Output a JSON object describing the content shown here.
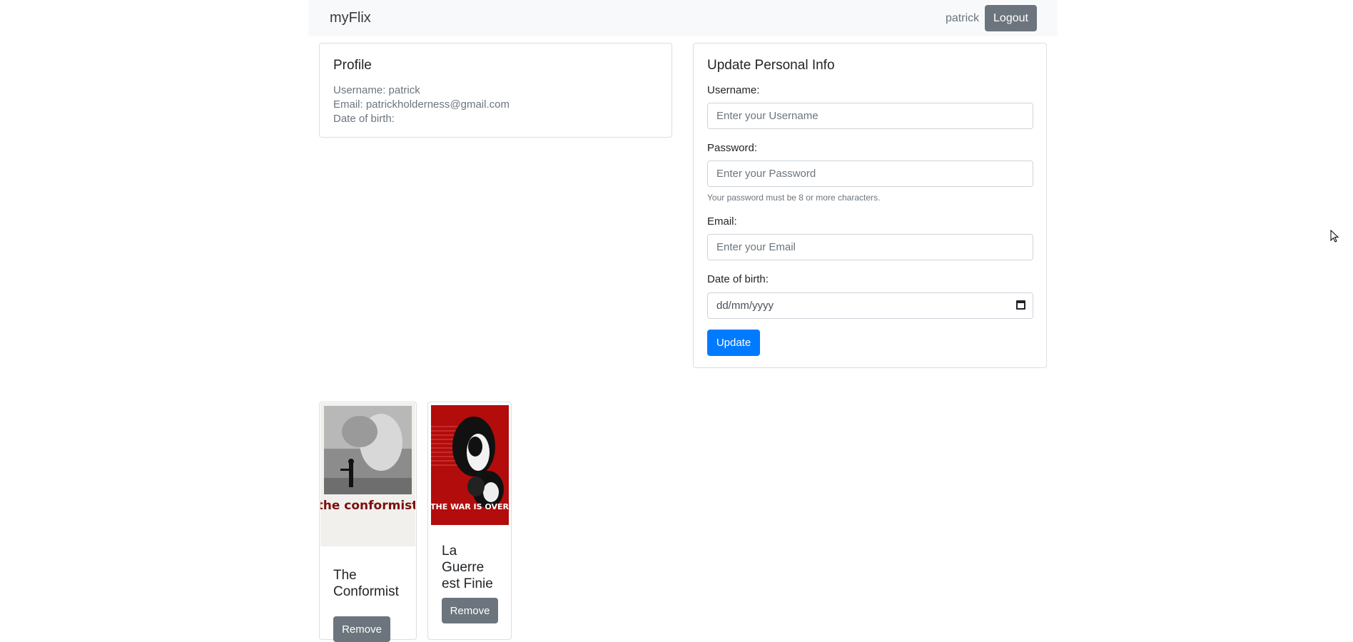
{
  "navbar": {
    "brand": "myFlix",
    "username": "patrick",
    "logout_label": "Logout"
  },
  "profile": {
    "title": "Profile",
    "username_line": "Username: patrick",
    "email_line": "Email: patrickholderness@gmail.com",
    "dob_line": "Date of birth:"
  },
  "update_form": {
    "title": "Update Personal Info",
    "username_label": "Username:",
    "username_placeholder": "Enter your Username",
    "password_label": "Password:",
    "password_placeholder": "Enter your Password",
    "password_help": "Your password must be 8 or more characters.",
    "email_label": "Email:",
    "email_placeholder": "Enter your Email",
    "dob_label": "Date of birth:",
    "dob_placeholder": "dd/mm/yyyy",
    "submit_label": "Update"
  },
  "favorites": [
    {
      "title": "The Conformist",
      "poster_text": "the conformist",
      "remove_label": "Remove"
    },
    {
      "title": "La Guerre est Finie",
      "poster_text": "THE WAR IS OVER",
      "remove_label": "Remove"
    }
  ],
  "colors": {
    "primary": "#007bff",
    "secondary": "#6c757d",
    "navbar_bg": "#f8f9fa",
    "poster2_red": "#b30c0c"
  }
}
